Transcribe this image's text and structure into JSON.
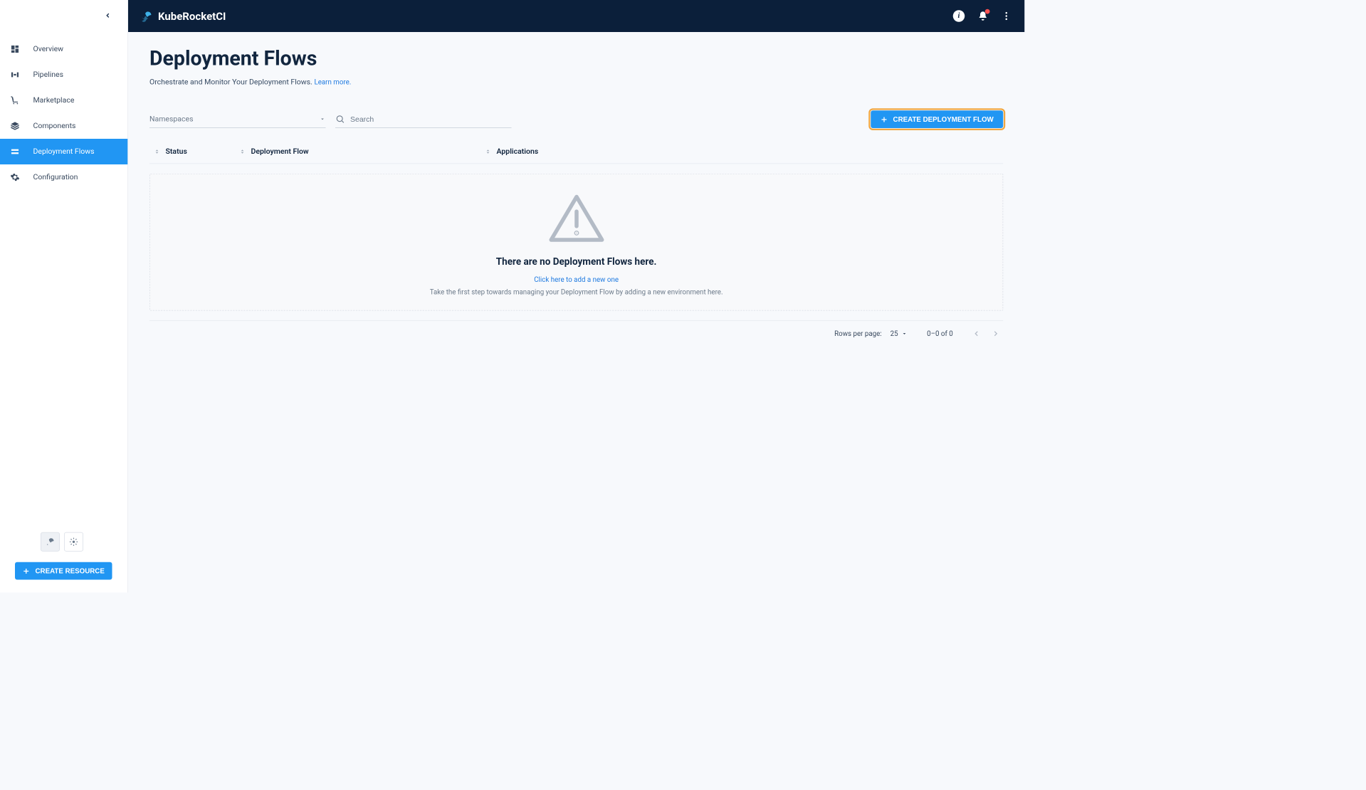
{
  "header": {
    "brand": "KubeRocketCI"
  },
  "sidebar": {
    "items": [
      {
        "label": "Overview"
      },
      {
        "label": "Pipelines"
      },
      {
        "label": "Marketplace"
      },
      {
        "label": "Components"
      },
      {
        "label": "Deployment Flows"
      },
      {
        "label": "Configuration"
      }
    ],
    "create_resource_label": "CREATE RESOURCE"
  },
  "page": {
    "title": "Deployment Flows",
    "subtitle": "Orchestrate and Monitor Your Deployment Flows.",
    "learn_more": "Learn more."
  },
  "toolbar": {
    "namespaces_label": "Namespaces",
    "search_placeholder": "Search",
    "create_button": "CREATE DEPLOYMENT FLOW"
  },
  "columns": {
    "status": "Status",
    "deployment_flow": "Deployment Flow",
    "applications": "Applications"
  },
  "empty": {
    "title": "There are no Deployment Flows here.",
    "link": "Click here to add a new one",
    "desc": "Take the first step towards managing your Deployment Flow by adding a new environment here."
  },
  "pagination": {
    "rows_label": "Rows per page:",
    "rows_value": "25",
    "range": "0–0 of 0"
  }
}
